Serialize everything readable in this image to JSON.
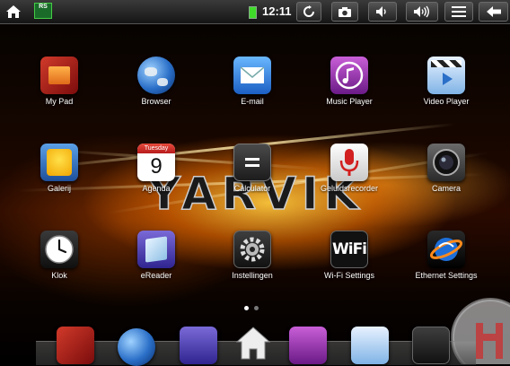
{
  "status_bar": {
    "time": "12:11",
    "rs_badge": "RS",
    "battery_color": "#3fdc2a",
    "left_icons": [
      "home-icon"
    ],
    "right_icons": [
      "refresh-icon",
      "camera-icon",
      "volume-down-icon",
      "volume-up-icon",
      "menu-icon",
      "back-icon"
    ]
  },
  "wallpaper": {
    "logo_text": "YARVIK",
    "accent": "#ff9a1a"
  },
  "apps": [
    {
      "label": "My Pad",
      "icon": "mypad-icon"
    },
    {
      "label": "Browser",
      "icon": "globe-icon"
    },
    {
      "label": "E-mail",
      "icon": "envelope-icon"
    },
    {
      "label": "Music Player",
      "icon": "music-note-icon"
    },
    {
      "label": "Video Player",
      "icon": "clapperboard-icon"
    },
    {
      "label": "Galerij",
      "icon": "gallery-icon"
    },
    {
      "label": "Agenda",
      "icon": "calendar-icon",
      "calendar_day": "Tuesday",
      "calendar_date": "9"
    },
    {
      "label": "Calculator",
      "icon": "calculator-icon"
    },
    {
      "label": "Geluidsrecorder",
      "icon": "microphone-icon"
    },
    {
      "label": "Camera",
      "icon": "camera-lens-icon"
    },
    {
      "label": "Klok",
      "icon": "clock-icon"
    },
    {
      "label": "eReader",
      "icon": "ereader-icon"
    },
    {
      "label": "Instellingen",
      "icon": "settings-gear-icon"
    },
    {
      "label": "Wi-Fi Settings",
      "icon": "wifi-icon",
      "wifi_text": "WiFi"
    },
    {
      "label": "Ethernet Settings",
      "icon": "ethernet-globe-icon"
    }
  ],
  "page_indicator": {
    "pages": 2,
    "current": 1
  },
  "dock": [
    "mypad-icon",
    "globe-icon",
    "ereader-icon",
    "home-icon",
    "music-note-icon",
    "clapperboard-icon",
    "settings-gear-icon"
  ]
}
